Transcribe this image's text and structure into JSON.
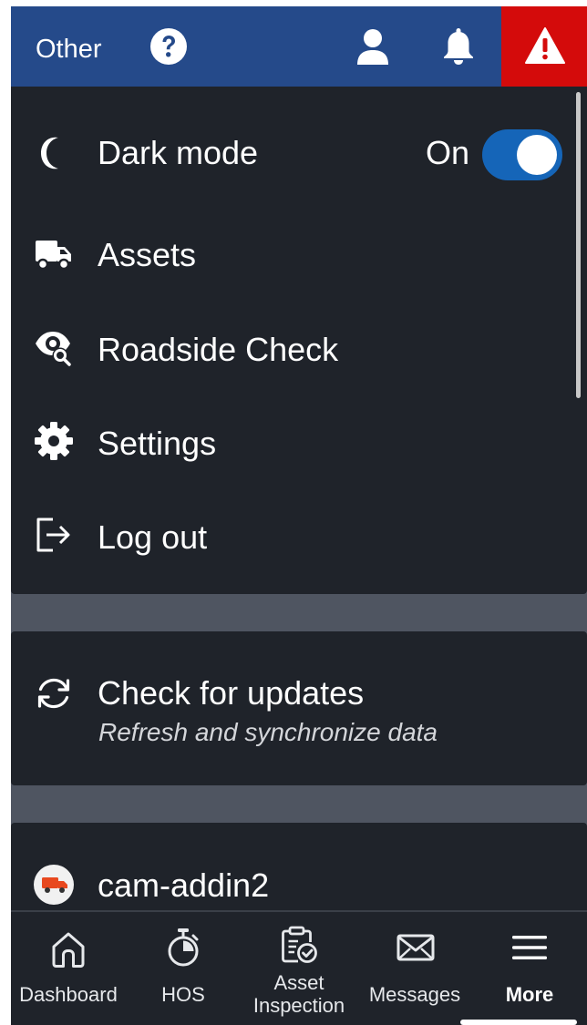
{
  "header": {
    "title": "Other",
    "icons": [
      "help-icon",
      "user-icon",
      "bell-icon",
      "warning-icon"
    ],
    "colors": {
      "background": "#254a8a",
      "alert": "#d40b0b"
    }
  },
  "menu": {
    "dark_mode": {
      "label": "Dark mode",
      "state_text": "On",
      "enabled": true,
      "icon": "moon-icon"
    },
    "items": [
      {
        "label": "Assets",
        "icon": "truck-icon"
      },
      {
        "label": "Roadside Check",
        "icon": "eye-search-icon"
      },
      {
        "label": "Settings",
        "icon": "gear-icon"
      },
      {
        "label": "Log out",
        "icon": "logout-icon"
      }
    ],
    "colors": {
      "card": "#1f232a",
      "toggle_on": "#1565b8"
    }
  },
  "updates": {
    "title": "Check for updates",
    "subtitle": "Refresh and synchronize data",
    "icon": "refresh-icon"
  },
  "addin": {
    "label": "cam-addin2",
    "icon": "truck-badge-icon"
  },
  "bottom_nav": {
    "items": [
      {
        "label": "Dashboard",
        "icon": "home-icon"
      },
      {
        "label": "HOS",
        "icon": "stopwatch-icon"
      },
      {
        "label": "Asset Inspection",
        "line1": "Asset",
        "line2": "Inspection",
        "icon": "clipboard-check-icon"
      },
      {
        "label": "Messages",
        "icon": "envelope-icon"
      },
      {
        "label": "More",
        "icon": "hamburger-icon",
        "active": true
      }
    ]
  }
}
